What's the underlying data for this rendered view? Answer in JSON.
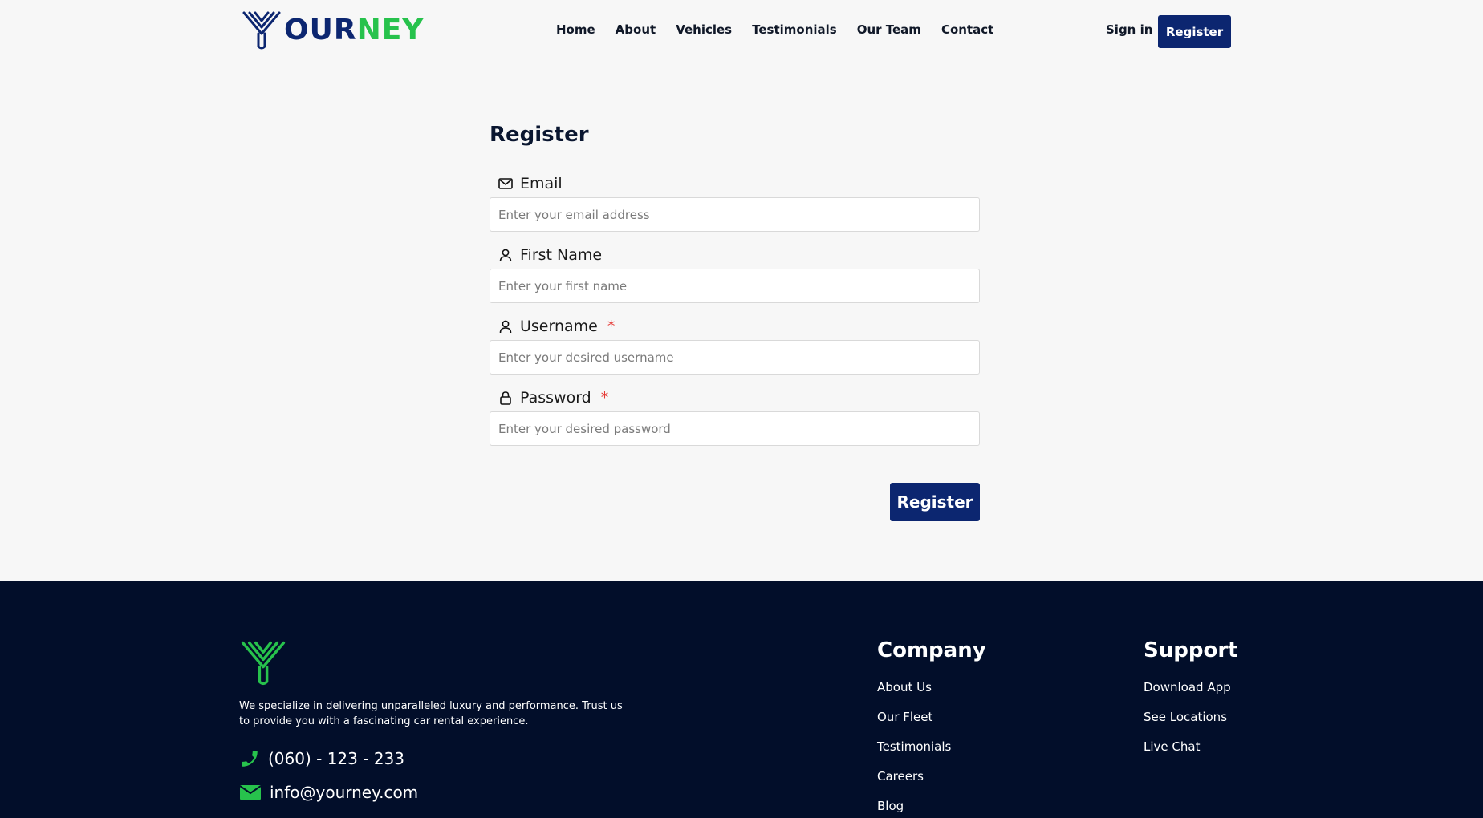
{
  "brand": {
    "logo_part1": "OUR",
    "logo_part2": "NEY",
    "navy": "#0c2670",
    "green": "#27c24c"
  },
  "nav": [
    "Home",
    "About",
    "Vehicles",
    "Testimonials",
    "Our Team",
    "Contact"
  ],
  "header": {
    "signin": "Sign in",
    "register": "Register"
  },
  "form": {
    "title": "Register",
    "email": {
      "label": "Email",
      "placeholder": "Enter your email address",
      "icon": "mail-icon"
    },
    "first_name": {
      "label": "First Name",
      "placeholder": "Enter your first name",
      "icon": "user-icon"
    },
    "username": {
      "label": "Username",
      "required": "*",
      "placeholder": "Enter your desired username",
      "icon": "user-icon"
    },
    "password": {
      "label": "Password",
      "required": "*",
      "placeholder": "Enter your desired password",
      "icon": "lock-icon"
    },
    "submit": "Register"
  },
  "footer": {
    "description": "We specialize in delivering unparalleled luxury and performance. Trust us to provide you with a fascinating car rental experience.",
    "phone": "(060) - 123 - 233",
    "email": "info@yourney.com",
    "company": {
      "title": "Company",
      "links": [
        "About Us",
        "Our Fleet",
        "Testimonials",
        "Careers",
        "Blog"
      ]
    },
    "support": {
      "title": "Support",
      "links": [
        "Download App",
        "See Locations",
        "Live Chat"
      ]
    }
  }
}
